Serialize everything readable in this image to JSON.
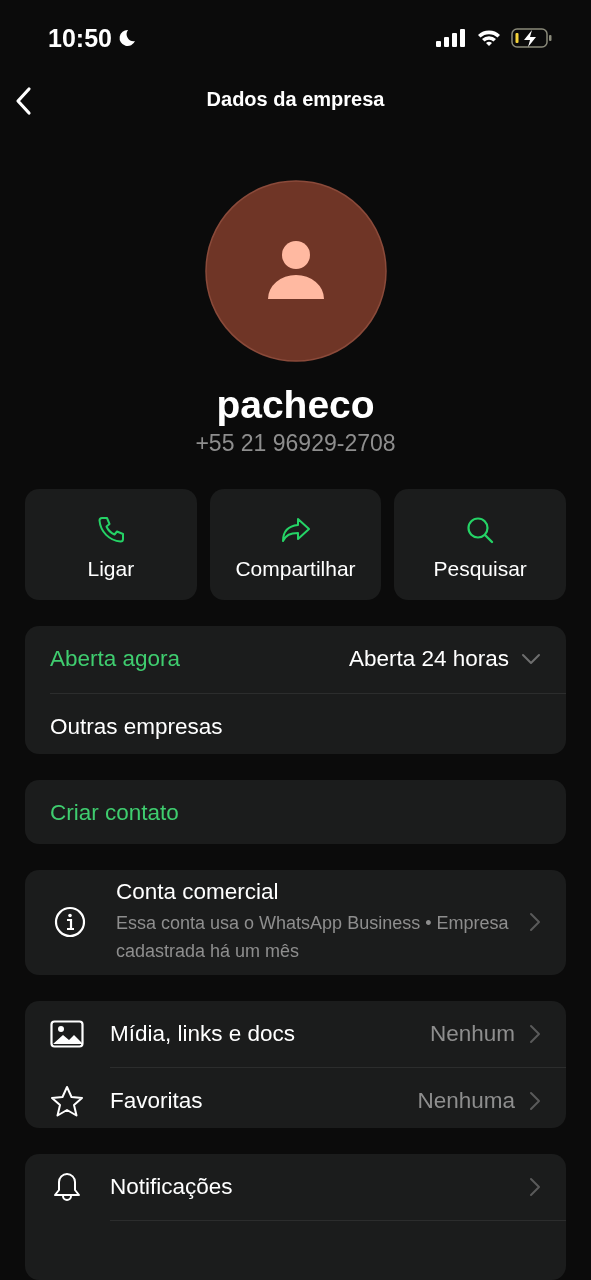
{
  "status_bar": {
    "time": "10:50"
  },
  "header": {
    "title": "Dados da empresa"
  },
  "profile": {
    "name": "pacheco",
    "phone": "+55 21 96929-2708"
  },
  "actions": [
    {
      "kind": "call",
      "label": "Ligar"
    },
    {
      "kind": "share",
      "label": "Compartilhar"
    },
    {
      "kind": "search",
      "label": "Pesquisar"
    }
  ],
  "hours": {
    "status": "Aberta agora",
    "schedule": "Aberta 24 horas",
    "expanded": false,
    "other": "Outras empresas"
  },
  "create_contact": "Criar contato",
  "business_account": {
    "title": "Conta comercial",
    "description": "Essa conta usa o WhatsApp Business • Empresa cadastrada há um mês"
  },
  "media_section": [
    {
      "kind": "media",
      "label": "Mídia, links e docs",
      "value": "Nenhum"
    },
    {
      "kind": "favorites",
      "label": "Favoritas",
      "value": "Nenhuma"
    }
  ],
  "settings_section": [
    {
      "kind": "notifications",
      "label": "Notificações"
    }
  ]
}
